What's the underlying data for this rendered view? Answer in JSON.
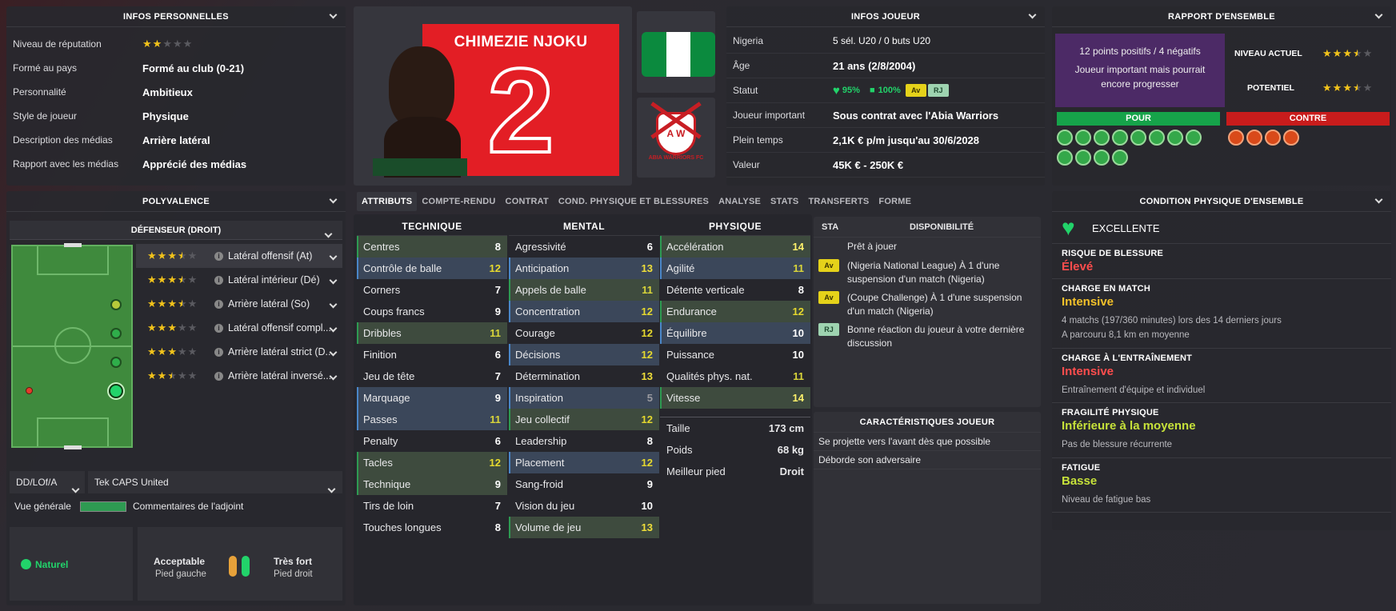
{
  "personal": {
    "title": "INFOS PERSONNELLES",
    "rows": [
      {
        "k": "Niveau de réputation",
        "stars": 2
      },
      {
        "k": "Formé au pays",
        "v": "Formé au club (0-21)"
      },
      {
        "k": "Personnalité",
        "v": "Ambitieux"
      },
      {
        "k": "Style de joueur",
        "v": "Physique"
      },
      {
        "k": "Description des médias",
        "v": "Arrière latéral"
      },
      {
        "k": "Rapport avec les médias",
        "v": "Apprécié des médias"
      }
    ]
  },
  "player": {
    "name": "CHIMEZIE NJOKU",
    "number": "2",
    "club_badge_text": "ABIA WARRIORS FC",
    "club_badge_letters": "A W",
    "shirt_color": "#e31e25",
    "nation_colors": [
      "#0b8a3e",
      "#ffffff",
      "#0b8a3e"
    ]
  },
  "info": {
    "title": "INFOS JOUEUR",
    "rows": [
      {
        "k": "Nigeria",
        "v": "5 sél. U20 / 0 buts U20"
      },
      {
        "k": "Âge",
        "v": "21 ans (2/8/2004)"
      },
      {
        "k": "Statut",
        "health": "95%",
        "morale": "100%",
        "badges": [
          "Av",
          "RJ"
        ]
      },
      {
        "k": "Joueur important",
        "v": "Sous contrat avec l'Abia Warriors"
      },
      {
        "k": "Plein temps",
        "v": "2,1K € p/m jusqu'au 30/6/2028"
      },
      {
        "k": "Valeur",
        "v": "45K € - 250K €"
      }
    ]
  },
  "overview": {
    "title": "RAPPORT D'ENSEMBLE",
    "summary1": "12 points positifs / 4 négatifs",
    "summary2": "Joueur important mais pourrait encore progresser",
    "current_label": "NIVEAU ACTUEL",
    "current_stars": 3.5,
    "potential_label": "POTENTIEL",
    "potential_stars": 3.5,
    "pro_label": "POUR",
    "con_label": "CONTRE",
    "pro_count": 12,
    "con_count": 4
  },
  "versatility": {
    "title": "POLYVALENCE",
    "position": "DÉFENSEUR (DROIT)",
    "roles": [
      {
        "name": "Latéral offensif (At)",
        "stars": 3.5
      },
      {
        "name": "Latéral intérieur (Dé)",
        "stars": 3.5
      },
      {
        "name": "Arrière latéral (So)",
        "stars": 3.5
      },
      {
        "name": "Latéral offensif compl...",
        "stars": 3
      },
      {
        "name": "Arrière latéral strict (D...",
        "stars": 3
      },
      {
        "name": "Arrière latéral inversé...",
        "stars": 2.5
      }
    ],
    "role_select": "DD/LOf/A",
    "staff_select": "Tek CAPS United",
    "overview_label": "Vue générale",
    "assistant_label": "Commentaires de l'adjoint",
    "natural_label": "Naturel",
    "left_foot": "Acceptable",
    "left_foot_label": "Pied gauche",
    "right_foot": "Très fort",
    "right_foot_label": "Pied droit"
  },
  "tabs": [
    "ATTRIBUTS",
    "COMPTE-RENDU",
    "CONTRAT",
    "COND. PHYSIQUE ET BLESSURES",
    "ANALYSE",
    "STATS",
    "TRANSFERTS",
    "FORME"
  ],
  "attributes": {
    "technique": {
      "title": "TECHNIQUE",
      "rows": [
        {
          "n": "Centres",
          "v": 8,
          "h": "g"
        },
        {
          "n": "Contrôle de balle",
          "v": 12,
          "h": "b"
        },
        {
          "n": "Corners",
          "v": 7,
          "h": ""
        },
        {
          "n": "Coups francs",
          "v": 9,
          "h": ""
        },
        {
          "n": "Dribbles",
          "v": 11,
          "h": "g"
        },
        {
          "n": "Finition",
          "v": 6,
          "h": ""
        },
        {
          "n": "Jeu de tête",
          "v": 7,
          "h": ""
        },
        {
          "n": "Marquage",
          "v": 9,
          "h": "b"
        },
        {
          "n": "Passes",
          "v": 11,
          "h": "b"
        },
        {
          "n": "Penalty",
          "v": 6,
          "h": ""
        },
        {
          "n": "Tacles",
          "v": 12,
          "h": "g"
        },
        {
          "n": "Technique",
          "v": 9,
          "h": "g"
        },
        {
          "n": "Tirs de loin",
          "v": 7,
          "h": ""
        },
        {
          "n": "Touches longues",
          "v": 8,
          "h": ""
        }
      ]
    },
    "mental": {
      "title": "MENTAL",
      "rows": [
        {
          "n": "Agressivité",
          "v": 6,
          "h": ""
        },
        {
          "n": "Anticipation",
          "v": 13,
          "h": "b"
        },
        {
          "n": "Appels de balle",
          "v": 11,
          "h": "g"
        },
        {
          "n": "Concentration",
          "v": 12,
          "h": "b"
        },
        {
          "n": "Courage",
          "v": 12,
          "h": ""
        },
        {
          "n": "Décisions",
          "v": 12,
          "h": "b"
        },
        {
          "n": "Détermination",
          "v": 13,
          "h": ""
        },
        {
          "n": "Inspiration",
          "v": 5,
          "h": "b"
        },
        {
          "n": "Jeu collectif",
          "v": 12,
          "h": "g"
        },
        {
          "n": "Leadership",
          "v": 8,
          "h": ""
        },
        {
          "n": "Placement",
          "v": 12,
          "h": "b"
        },
        {
          "n": "Sang-froid",
          "v": 9,
          "h": ""
        },
        {
          "n": "Vision du jeu",
          "v": 10,
          "h": ""
        },
        {
          "n": "Volume de jeu",
          "v": 13,
          "h": "g"
        }
      ]
    },
    "physique": {
      "title": "PHYSIQUE",
      "rows": [
        {
          "n": "Accélération",
          "v": 14,
          "h": "g"
        },
        {
          "n": "Agilité",
          "v": 11,
          "h": "b"
        },
        {
          "n": "Détente verticale",
          "v": 8,
          "h": ""
        },
        {
          "n": "Endurance",
          "v": 12,
          "h": "g"
        },
        {
          "n": "Équilibre",
          "v": 10,
          "h": "b"
        },
        {
          "n": "Puissance",
          "v": 10,
          "h": ""
        },
        {
          "n": "Qualités phys. nat.",
          "v": 11,
          "h": ""
        },
        {
          "n": "Vitesse",
          "v": 14,
          "h": "g"
        }
      ]
    },
    "body": [
      {
        "k": "Taille",
        "v": "173 cm"
      },
      {
        "k": "Poids",
        "v": "68 kg"
      },
      {
        "k": "Meilleur pied",
        "v": "Droit"
      }
    ]
  },
  "availability": {
    "sta": "STA",
    "title": "DISPONIBILITÉ",
    "rows": [
      {
        "badge": "",
        "text": "Prêt à jouer"
      },
      {
        "badge": "Av",
        "text": "(Nigeria National League) À 1 d'une suspension d'un match (Nigeria)"
      },
      {
        "badge": "Av",
        "text": "(Coupe Challenge) À 1 d'une suspension d'un match (Nigeria)"
      },
      {
        "badge": "RJ",
        "text": "Bonne réaction du joueur à votre dernière discussion"
      }
    ]
  },
  "traits": {
    "title": "CARACTÉRISTIQUES JOUEUR",
    "rows": [
      "Se projette vers l'avant dès que possible",
      "Déborde son adversaire"
    ]
  },
  "condition": {
    "title": "CONDITION PHYSIQUE D'ENSEMBLE",
    "overall": "EXCELLENTE",
    "sections": [
      {
        "t": "RISQUE DE BLESSURE",
        "v": "Élevé",
        "color": "#ff4d4d",
        "d": []
      },
      {
        "t": "CHARGE EN MATCH",
        "v": "Intensive",
        "color": "#f3c12a",
        "d": [
          "4 matchs (197/360 minutes) lors des 14 derniers jours",
          "A parcouru 8,1 km en moyenne"
        ]
      },
      {
        "t": "CHARGE À L'ENTRAÎNEMENT",
        "v": "Intensive",
        "color": "#ff4d4d",
        "d": [
          "Entraînement d'équipe et individuel"
        ]
      },
      {
        "t": "FRAGILITÉ PHYSIQUE",
        "v": "Inférieure à la moyenne",
        "color": "#c6e13a",
        "d": [
          "Pas de blessure récurrente"
        ]
      },
      {
        "t": "FATIGUE",
        "v": "Basse",
        "color": "#c6e13a",
        "d": [
          "Niveau de fatigue bas"
        ]
      }
    ]
  }
}
